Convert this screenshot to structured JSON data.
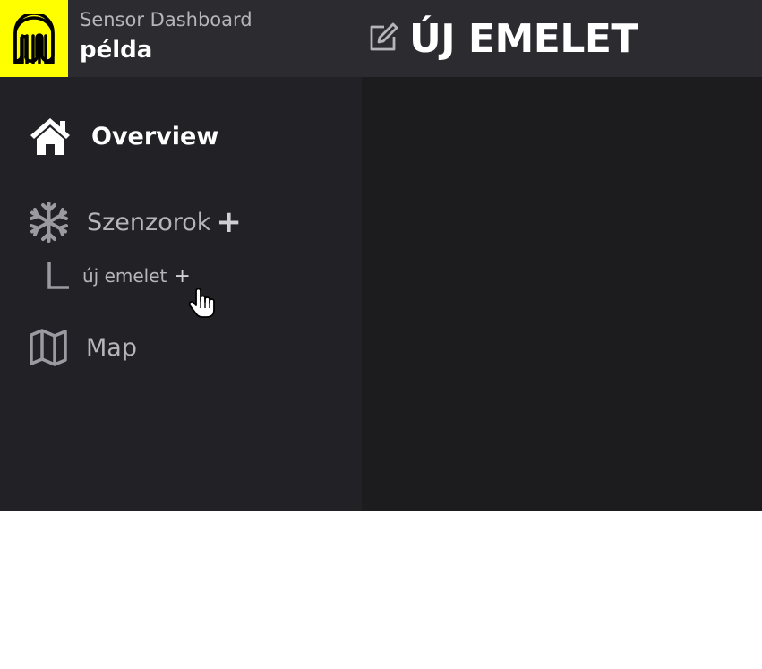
{
  "header": {
    "app_name": "Sensor Dashboard",
    "instance_name": "példa",
    "page_title": "ÚJ EMELET",
    "logo_icon": "logo-icon",
    "edit_icon": "edit-icon"
  },
  "sidebar": {
    "items": [
      {
        "label": "Overview",
        "icon": "home-icon",
        "active": true
      },
      {
        "label": "Szenzorok",
        "icon": "snowflake-icon",
        "action": "+"
      },
      {
        "label": "új emelet",
        "icon": "tree-branch-icon",
        "action": "+"
      },
      {
        "label": "Map",
        "icon": "map-icon"
      }
    ]
  },
  "colors": {
    "accent": "#ffff00",
    "header_bg": "#2b2b30",
    "sidebar_bg": "#222226",
    "main_bg": "#1c1c1e"
  }
}
